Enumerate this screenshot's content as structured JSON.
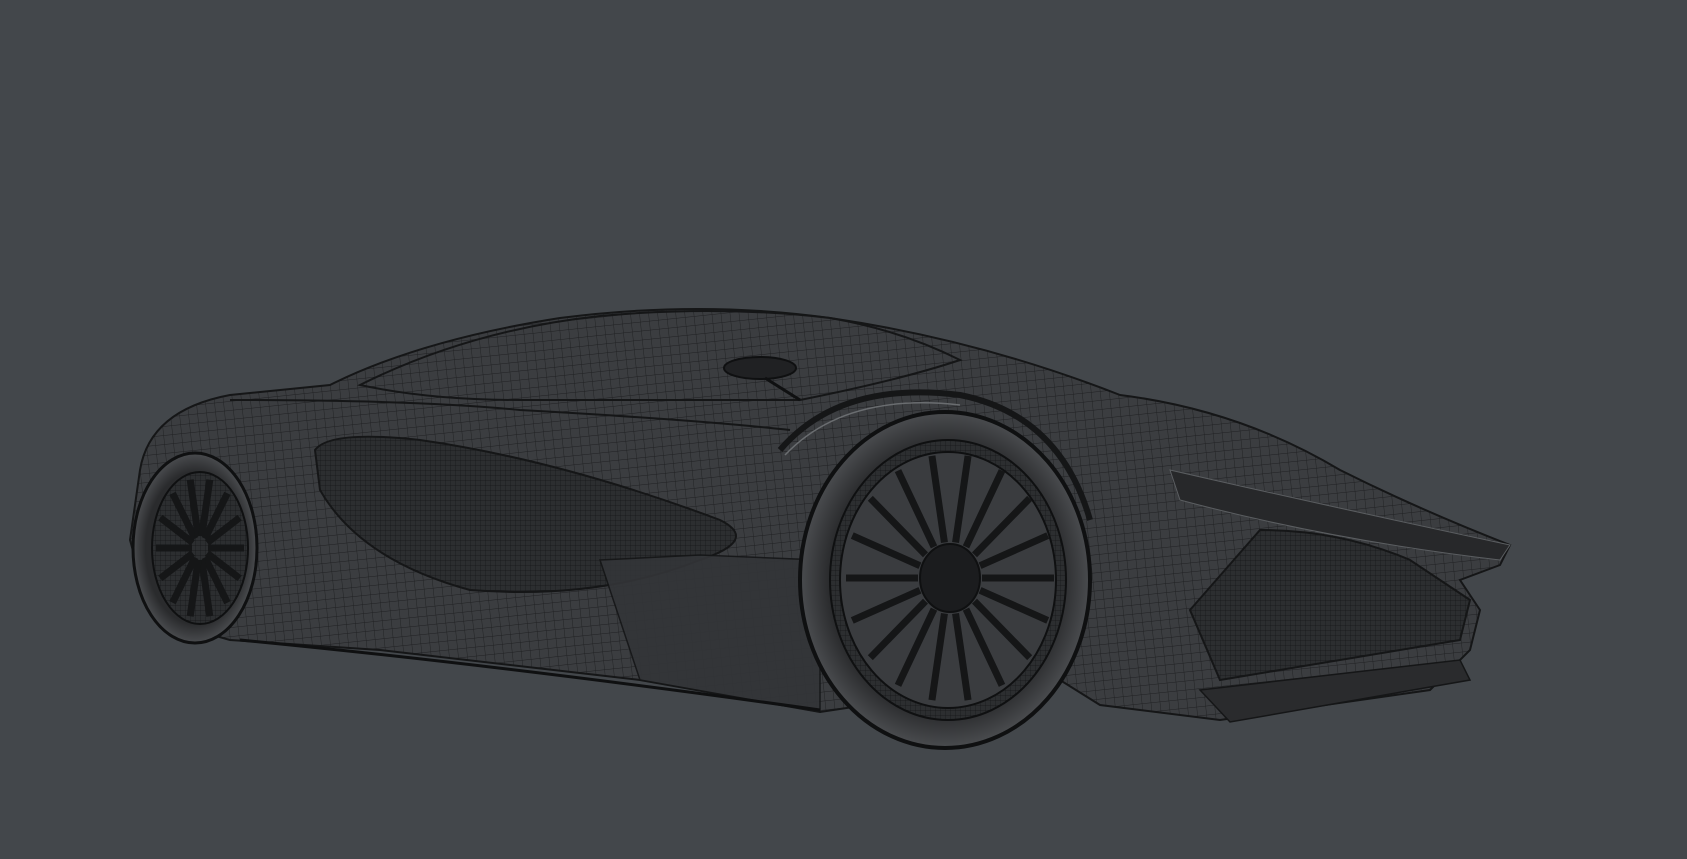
{
  "viewport": {
    "background": "#43474b",
    "subject": "wireframe-car",
    "body_color": "#3a3c3f",
    "mesh_color": "#1e1f21",
    "highlight_color": "#6a6d70",
    "wheel_spokes_front": 18,
    "wheel_spokes_rear": 14
  }
}
